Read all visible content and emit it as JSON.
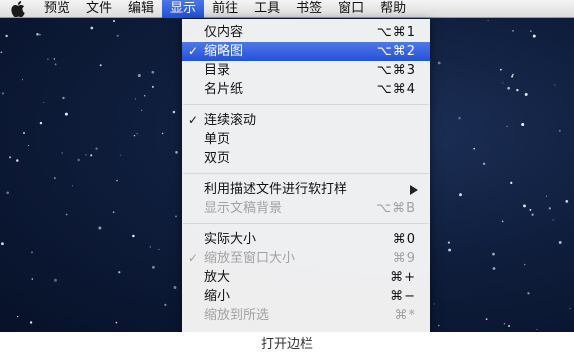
{
  "menubar": {
    "apple_icon": "apple-logo-icon",
    "items": [
      {
        "label": "预览",
        "active": false
      },
      {
        "label": "文件",
        "active": false
      },
      {
        "label": "编辑",
        "active": false
      },
      {
        "label": "显示",
        "active": true
      },
      {
        "label": "前往",
        "active": false
      },
      {
        "label": "工具",
        "active": false
      },
      {
        "label": "书签",
        "active": false
      },
      {
        "label": "窗口",
        "active": false
      },
      {
        "label": "帮助",
        "active": false
      }
    ]
  },
  "view_menu": {
    "items": [
      {
        "label": "仅内容",
        "shortcut": "⌥⌘1",
        "checked": false,
        "enabled": true,
        "highlighted": false
      },
      {
        "label": "缩略图",
        "shortcut": "⌥⌘2",
        "checked": true,
        "enabled": true,
        "highlighted": true
      },
      {
        "label": "目录",
        "shortcut": "⌥⌘3",
        "checked": false,
        "enabled": true,
        "highlighted": false
      },
      {
        "label": "名片纸",
        "shortcut": "⌥⌘4",
        "checked": false,
        "enabled": true,
        "highlighted": false
      },
      {
        "label": "连续滚动",
        "shortcut": "",
        "checked": true,
        "enabled": true,
        "highlighted": false
      },
      {
        "label": "单页",
        "shortcut": "",
        "checked": false,
        "enabled": true,
        "highlighted": false
      },
      {
        "label": "双页",
        "shortcut": "",
        "checked": false,
        "enabled": true,
        "highlighted": false
      },
      {
        "label": "利用描述文件进行软打样",
        "shortcut": "",
        "checked": false,
        "enabled": true,
        "highlighted": false,
        "submenu": true
      },
      {
        "label": "显示文稿背景",
        "shortcut": "⌥⌘B",
        "checked": false,
        "enabled": false,
        "highlighted": false
      },
      {
        "label": "实际大小",
        "shortcut": "⌘0",
        "checked": false,
        "enabled": true,
        "highlighted": false
      },
      {
        "label": "缩放至窗口大小",
        "shortcut": "⌘9",
        "checked": true,
        "enabled": false,
        "highlighted": false
      },
      {
        "label": "放大",
        "shortcut": "⌘+",
        "checked": false,
        "enabled": true,
        "highlighted": false
      },
      {
        "label": "缩小",
        "shortcut": "⌘−",
        "checked": false,
        "enabled": true,
        "highlighted": false
      },
      {
        "label": "缩放到所选",
        "shortcut": "⌘*",
        "checked": false,
        "enabled": false,
        "highlighted": false
      }
    ],
    "check_mark": "✓",
    "submenu_icon": "triangle-right-icon"
  },
  "caption": "打开边栏",
  "colors": {
    "highlight": "#2f5fdc",
    "disabled_text": "#a2a2a2",
    "desktop_bg": "#0f1e3d"
  }
}
